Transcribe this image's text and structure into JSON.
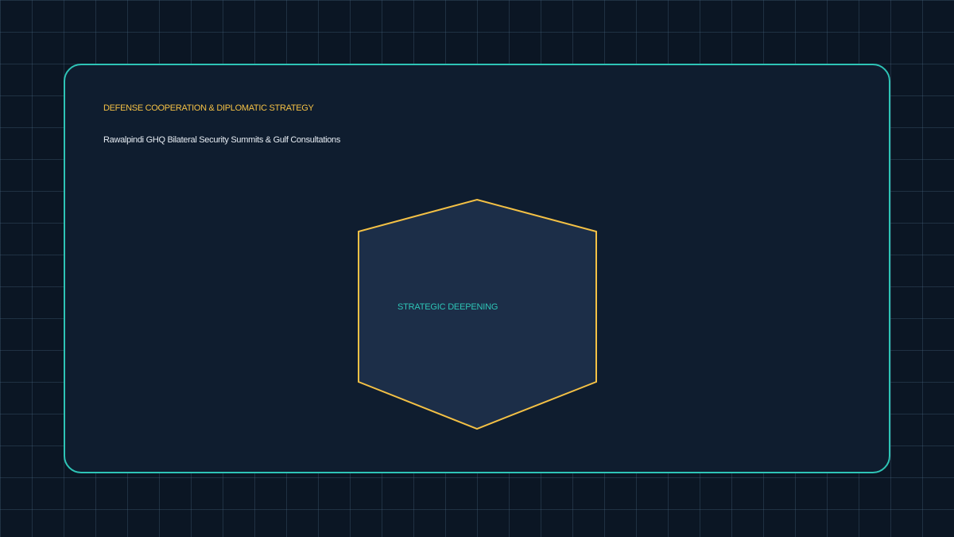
{
  "slide": {
    "eyebrow": "DEFENSE COOPERATION & DIPLOMATIC STRATEGY",
    "subtitle": "Rawalpindi GHQ Bilateral Security Summits & Gulf Consultations"
  },
  "diagram": {
    "node_label": "STRATEGIC DEEPENING"
  },
  "colors": {
    "background": "#0b1624",
    "panel": "#0f1d2f",
    "panel_border": "#2ec4b6",
    "accent_gold": "#f4c145",
    "hex_fill": "#1c2e48",
    "label_teal": "#2ec4b6",
    "text_light": "#e6ecf3"
  }
}
